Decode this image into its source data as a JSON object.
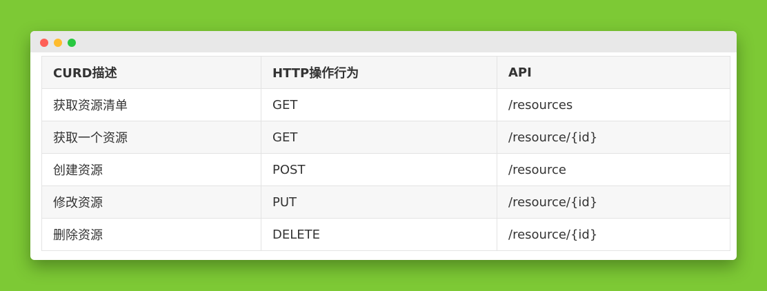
{
  "window": {
    "controls": {
      "close_color": "#fe5f57",
      "minimize_color": "#febc2e",
      "maximize_color": "#28c840"
    }
  },
  "table": {
    "headers": [
      "CURD描述",
      "HTTP操作行为",
      "API"
    ],
    "rows": [
      [
        "获取资源清单",
        "GET",
        "/resources"
      ],
      [
        "获取一个资源",
        "GET",
        "/resource/{id}"
      ],
      [
        "创建资源",
        "POST",
        "/resource"
      ],
      [
        "修改资源",
        "PUT",
        "/resource/{id}"
      ],
      [
        "删除资源",
        "DELETE",
        "/resource/{id}"
      ]
    ]
  },
  "colors": {
    "background": "#7dc935",
    "titlebar": "#e8e8e8",
    "border": "#e3e3e3",
    "stripe": "#f7f7f7"
  }
}
